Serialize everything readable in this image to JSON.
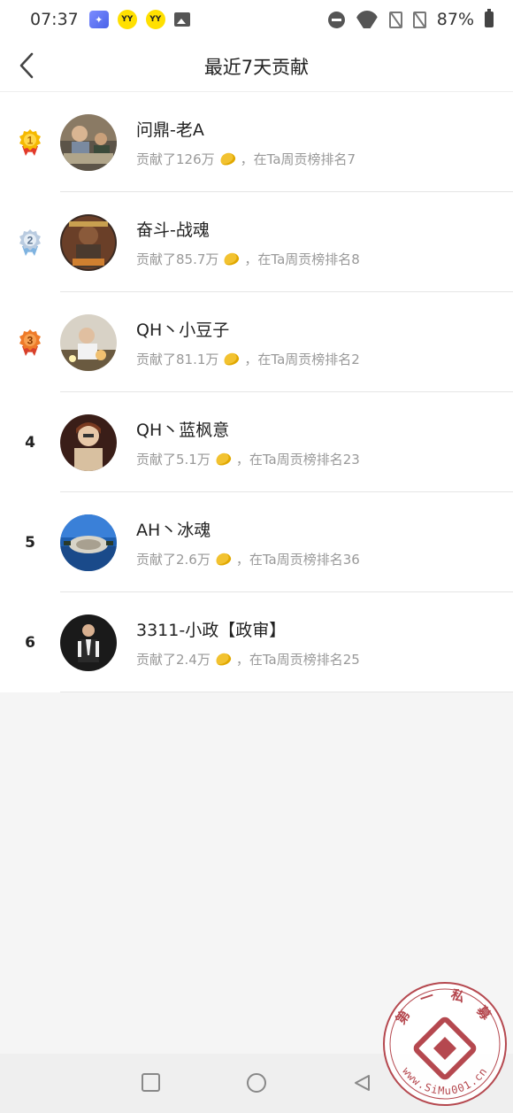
{
  "status_bar": {
    "time": "07:37",
    "battery": "87%",
    "icons": [
      "app-icon",
      "yy-icon",
      "yy-icon",
      "gallery-icon",
      "do-not-disturb-icon",
      "wifi-icon",
      "no-sim-icon",
      "no-sim-icon",
      "battery-icon"
    ],
    "yy_label": "YY"
  },
  "header": {
    "title": "最近7天贡献",
    "back_icon": "chevron-left-icon"
  },
  "list": [
    {
      "rank": "1",
      "medal": "gold",
      "name": "问鼎-老A",
      "contribution": "贡献了126万",
      "ranking": "，在Ta周贡榜排名7"
    },
    {
      "rank": "2",
      "medal": "silver",
      "name": "奋斗-战魂",
      "contribution": "贡献了85.7万",
      "ranking": "，在Ta周贡榜排名8"
    },
    {
      "rank": "3",
      "medal": "bronze",
      "name": "QH丶小豆子",
      "contribution": "贡献了81.1万",
      "ranking": "，在Ta周贡榜排名2"
    },
    {
      "rank": "4",
      "medal": "",
      "name": "QH丶蓝枫意",
      "contribution": "贡献了5.1万",
      "ranking": "，在Ta周贡榜排名23"
    },
    {
      "rank": "5",
      "medal": "",
      "name": "AH丶冰魂",
      "contribution": "贡献了2.6万",
      "ranking": "，在Ta周贡榜排名36"
    },
    {
      "rank": "6",
      "medal": "",
      "name": "3311-小政【政审】",
      "contribution": "贡献了2.4万",
      "ranking": "，在Ta周贡榜排名25"
    }
  ],
  "watermark": {
    "top_text": "第 一 私 募",
    "bottom_text": "www.SiMu001.cn"
  },
  "colors": {
    "gold": "#f0b400",
    "silver": "#9fb8d0",
    "bronze": "#e8782a",
    "coin": "#f2c230",
    "watermark": "#b5484f"
  }
}
